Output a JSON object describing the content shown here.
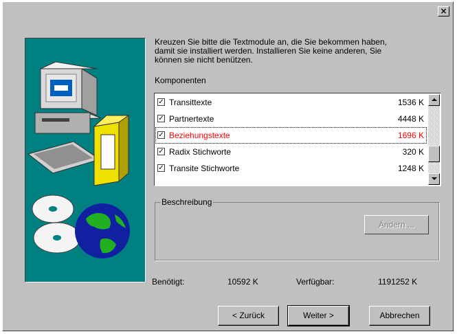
{
  "window": {
    "close_glyph": "×"
  },
  "instructions": {
    "lines": [
      "Kreuzen Sie bitte die Textmodule an, die Sie bekommen haben,",
      "damit sie installiert werden. Installieren Sie keine anderen, Sie",
      "können sie nicht benützen."
    ],
    "components_label": "Komponenten"
  },
  "components": [
    {
      "name": "Transittexte",
      "size": "1536 K",
      "checked": true,
      "selected": false
    },
    {
      "name": "Partnertexte",
      "size": "4448 K",
      "checked": true,
      "selected": false
    },
    {
      "name": "Beziehungstexte",
      "size": "1696 K",
      "checked": true,
      "selected": true
    },
    {
      "name": "Radix Stichworte",
      "size": "320 K",
      "checked": true,
      "selected": false
    },
    {
      "name": "Transite Stichworte",
      "size": "1248 K",
      "checked": true,
      "selected": false
    }
  ],
  "description": {
    "legend": "Beschreibung",
    "change_button": "Ändern ..."
  },
  "space": {
    "required_label": "Benötigt:",
    "required_value": "10592 K",
    "available_label": "Verfügbar:",
    "available_value": "1191252 K"
  },
  "buttons": {
    "back": "< Zurück",
    "next": "Weiter >",
    "cancel": "Abbrechen"
  },
  "colors": {
    "face": "#c0c0c0",
    "art_background": "#008080",
    "selected_text": "#ff0000"
  }
}
